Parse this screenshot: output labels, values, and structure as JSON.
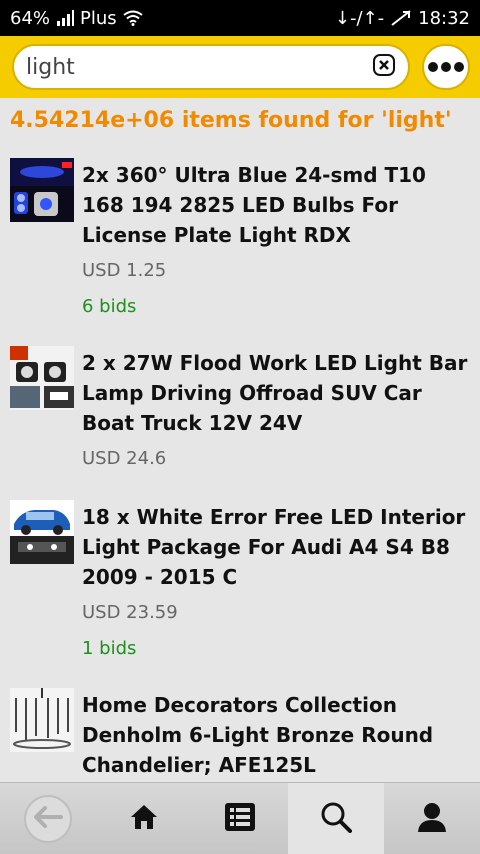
{
  "status_bar": {
    "battery": "64%",
    "carrier": "Plus",
    "data_indicator": "↓-/↑-",
    "time": "18:32"
  },
  "search": {
    "value": "light",
    "placeholder": ""
  },
  "results": {
    "count_text": "4.54214e+06 items found for 'light'"
  },
  "items": [
    {
      "title": "2x 360° Ultra Blue 24-smd T10 168 194 2825 LED Bulbs For License Plate Light RDX",
      "price": "USD 1.25",
      "bids": "6 bids",
      "thumb": "blue-led-bulb-thumbnail"
    },
    {
      "title": "2 x 27W Flood Work LED Light Bar Lamp Driving Offroad SUV Car Boat Truck 12V 24V",
      "price": "USD 24.6",
      "bids": "",
      "thumb": "flood-work-light-thumbnail"
    },
    {
      "title": "18 x White Error Free LED Interior Light Package For Audi A4 S4 B8 2009 - 2015 C",
      "price": "USD 23.59",
      "bids": "1 bids",
      "thumb": "audi-car-thumbnail"
    },
    {
      "title": "Home Decorators Collection Denholm 6-Light Bronze Round Chandelier; AFE125L",
      "price": "",
      "bids": "",
      "thumb": "chandelier-thumbnail"
    }
  ],
  "toolbar": {
    "buttons": [
      "back",
      "home",
      "list",
      "search",
      "profile"
    ],
    "active": "search"
  },
  "colors": {
    "header": "#f5cc00",
    "results_count": "#f28a00",
    "bids": "#1f8f1f",
    "price": "#666666"
  }
}
